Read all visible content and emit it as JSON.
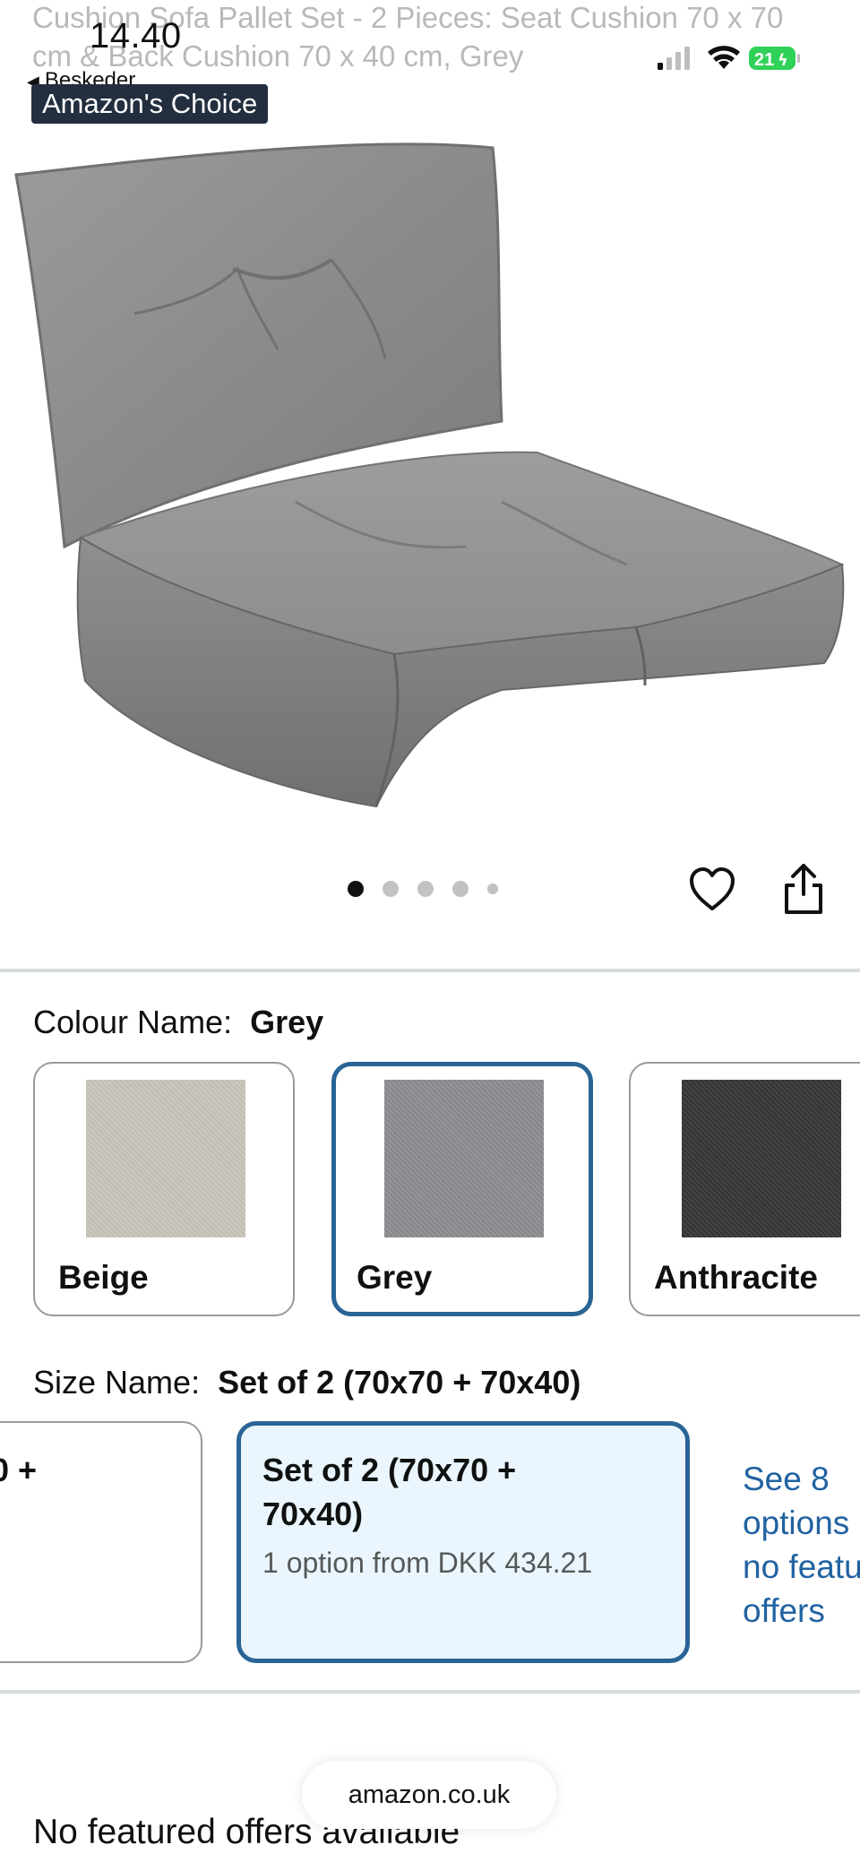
{
  "product": {
    "title_line1": "Cushion Sofa Pallet Set - 2 Pieces: Seat Cushion 70 x 70",
    "title_line2": "cm & Back Cushion 70 x 40 cm, Grey",
    "badge": "Amazon's Choice",
    "image": {
      "carousel_count": 5,
      "active_index": 0
    }
  },
  "status_bar": {
    "time": "14.40",
    "back_label": "Beskeder",
    "battery": "21"
  },
  "colour": {
    "label": "Colour Name:",
    "selected": "Grey",
    "options": [
      {
        "name": "Beige",
        "swatch_color": "#c9c4bb"
      },
      {
        "name": "Grey",
        "swatch_color": "#8e8f91"
      },
      {
        "name": "Anthracite",
        "swatch_color": "#3d3d3f"
      }
    ]
  },
  "size": {
    "label": "Size Name:",
    "selected": "Set of 2 (70x70 + 70x40)",
    "options": [
      {
        "title": "0 +"
      },
      {
        "title_line1": "Set of 2 (70x70 +",
        "title_line2": "70x40)",
        "sub": "1 option from DKK 434.21"
      }
    ],
    "see_more": [
      "See 8",
      "options",
      "no featu",
      "offers"
    ]
  },
  "browser": {
    "url": "amazon.co.uk"
  },
  "offers": {
    "text": "No featured offers available"
  }
}
